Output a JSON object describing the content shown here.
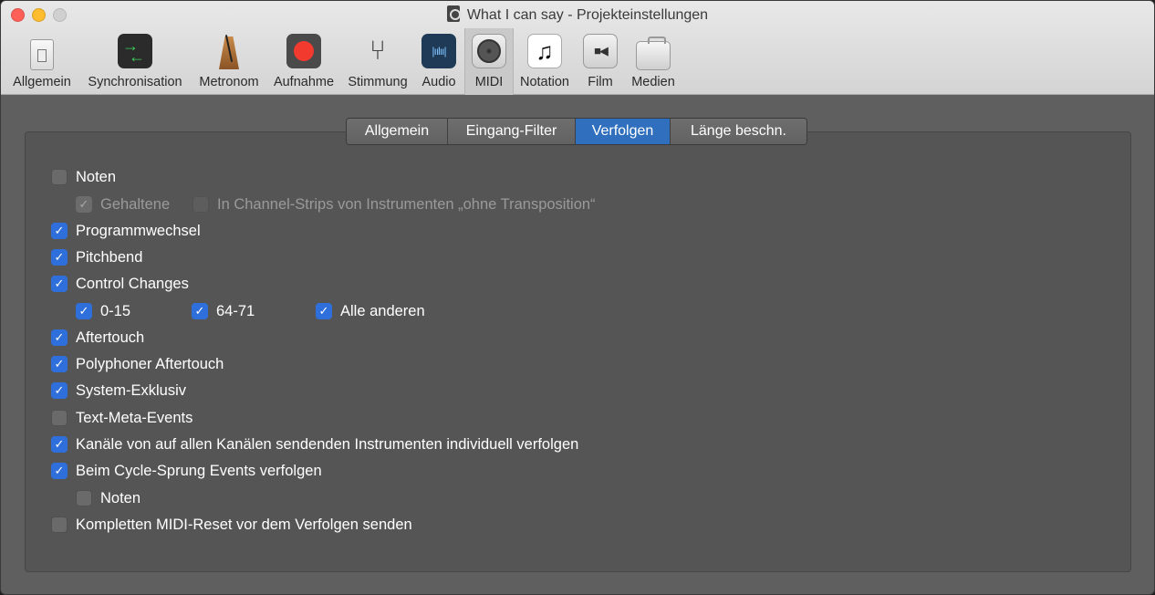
{
  "window": {
    "title": "What I can say - Projekteinstellungen"
  },
  "toolbar": {
    "items": [
      {
        "label": "Allgemein",
        "icon": "switch-icon"
      },
      {
        "label": "Synchronisation",
        "icon": "sync-arrows-icon"
      },
      {
        "label": "Metronom",
        "icon": "metronome-icon"
      },
      {
        "label": "Aufnahme",
        "icon": "record-icon"
      },
      {
        "label": "Stimmung",
        "icon": "tuning-fork-icon"
      },
      {
        "label": "Audio",
        "icon": "waveform-icon"
      },
      {
        "label": "MIDI",
        "icon": "midi-connector-icon",
        "active": true
      },
      {
        "label": "Notation",
        "icon": "music-note-icon"
      },
      {
        "label": "Film",
        "icon": "video-camera-icon"
      },
      {
        "label": "Medien",
        "icon": "briefcase-icon"
      }
    ]
  },
  "tabs": [
    {
      "label": "Allgemein",
      "active": false
    },
    {
      "label": "Eingang-Filter",
      "active": false
    },
    {
      "label": "Verfolgen",
      "active": true
    },
    {
      "label": "Länge beschn.",
      "active": false
    }
  ],
  "options": {
    "noten": {
      "label": "Noten",
      "checked": false
    },
    "gehaltene": {
      "label": "Gehaltene",
      "checked": true,
      "disabled": true
    },
    "channel_strips": {
      "label": "In Channel-Strips von Instrumenten „ohne Transposition“",
      "checked": false,
      "disabled": true
    },
    "programmwechsel": {
      "label": "Programmwechsel",
      "checked": true
    },
    "pitchbend": {
      "label": "Pitchbend",
      "checked": true
    },
    "control_changes": {
      "label": "Control Changes",
      "checked": true
    },
    "cc_0_15": {
      "label": "0-15",
      "checked": true
    },
    "cc_64_71": {
      "label": "64-71",
      "checked": true
    },
    "cc_alle_anderen": {
      "label": "Alle anderen",
      "checked": true
    },
    "aftertouch": {
      "label": "Aftertouch",
      "checked": true
    },
    "poly_aftertouch": {
      "label": "Polyphoner Aftertouch",
      "checked": true
    },
    "system_exklusiv": {
      "label": "System-Exklusiv",
      "checked": true
    },
    "text_meta": {
      "label": "Text-Meta-Events",
      "checked": false
    },
    "kanaele": {
      "label": "Kanäle von auf allen Kanälen sendenden Instrumenten individuell verfolgen",
      "checked": true
    },
    "cycle_sprung": {
      "label": "Beim Cycle-Sprung Events verfolgen",
      "checked": true
    },
    "cycle_noten": {
      "label": "Noten",
      "checked": false
    },
    "midi_reset": {
      "label": "Kompletten MIDI-Reset vor dem Verfolgen senden",
      "checked": false
    }
  },
  "colors": {
    "accent": "#2f6fdb",
    "panel": "#555555",
    "background": "#5f5f5f"
  }
}
